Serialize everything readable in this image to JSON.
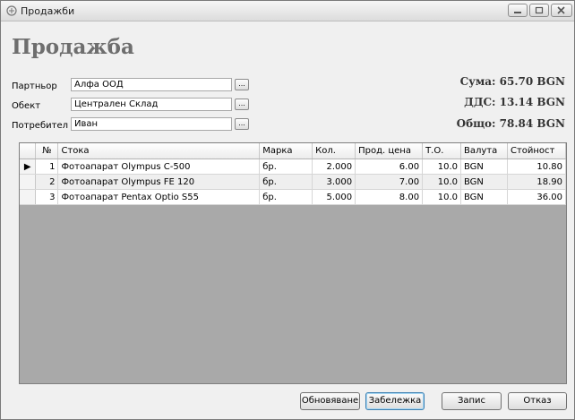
{
  "window": {
    "title": "Продажби"
  },
  "heading": "Продажба",
  "form": {
    "partner_label": "Партньор",
    "partner_value": "Алфа ООД",
    "object_label": "Обект",
    "object_value": "Централен Склад",
    "consumer_label": "Потребител",
    "consumer_value": "Иван",
    "browse_label": "..."
  },
  "totals": {
    "sum": "Сума: 65.70 BGN",
    "vat": "ДДС: 13.14 BGN",
    "total": "Общо: 78.84 BGN"
  },
  "grid": {
    "columns": [
      "№",
      "Стока",
      "Марка",
      "Кол.",
      "Прод. цена",
      "Т.О.",
      "Валута",
      "Стойност"
    ],
    "rows": [
      [
        "1",
        "Фотоапарат Olympus C-500",
        "бр.",
        "2.000",
        "6.00",
        "10.0",
        "BGN",
        "10.80"
      ],
      [
        "2",
        "Фотоапарат Olympus FE 120",
        "бр.",
        "3.000",
        "7.00",
        "10.0",
        "BGN",
        "18.90"
      ],
      [
        "3",
        "Фотоапарат Pentax Optio S55",
        "бр.",
        "5.000",
        "8.00",
        "10.0",
        "BGN",
        "36.00"
      ]
    ],
    "current_row_marker": "▶"
  },
  "buttons": {
    "refresh": "Обновяване",
    "note": "Забележка",
    "save": "Запис",
    "cancel": "Отказ"
  },
  "icons": {
    "app": "window-app-icon",
    "minimize": "minimize-icon",
    "maximize": "maximize-icon",
    "close": "close-icon"
  }
}
